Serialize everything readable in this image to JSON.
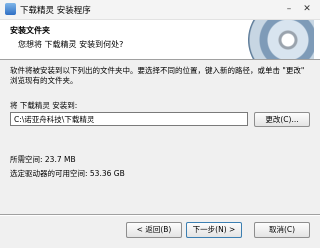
{
  "window": {
    "title": "下载精灵 安装程序"
  },
  "header": {
    "heading": "安装文件夹",
    "subheading": "您想将 下载精灵 安装到何处?"
  },
  "body": {
    "description": "软件将被安装到以下列出的文件夹中。要选择不同的位置，键入新的路径，或单击 \"更改\" 浏览现有的文件夹。",
    "install_label": "将 下载精灵 安装到:",
    "path_value": "C:\\诺亚舟科技\\下载精灵",
    "browse_label": "更改(C)...",
    "required_space": "所需空间:  23.7 MB",
    "free_space": "选定驱动器的可用空间:  53.36 GB"
  },
  "footer": {
    "back_label": "< 返回(B)",
    "next_label": "下一步(N) >",
    "cancel_label": "取消(C)"
  }
}
